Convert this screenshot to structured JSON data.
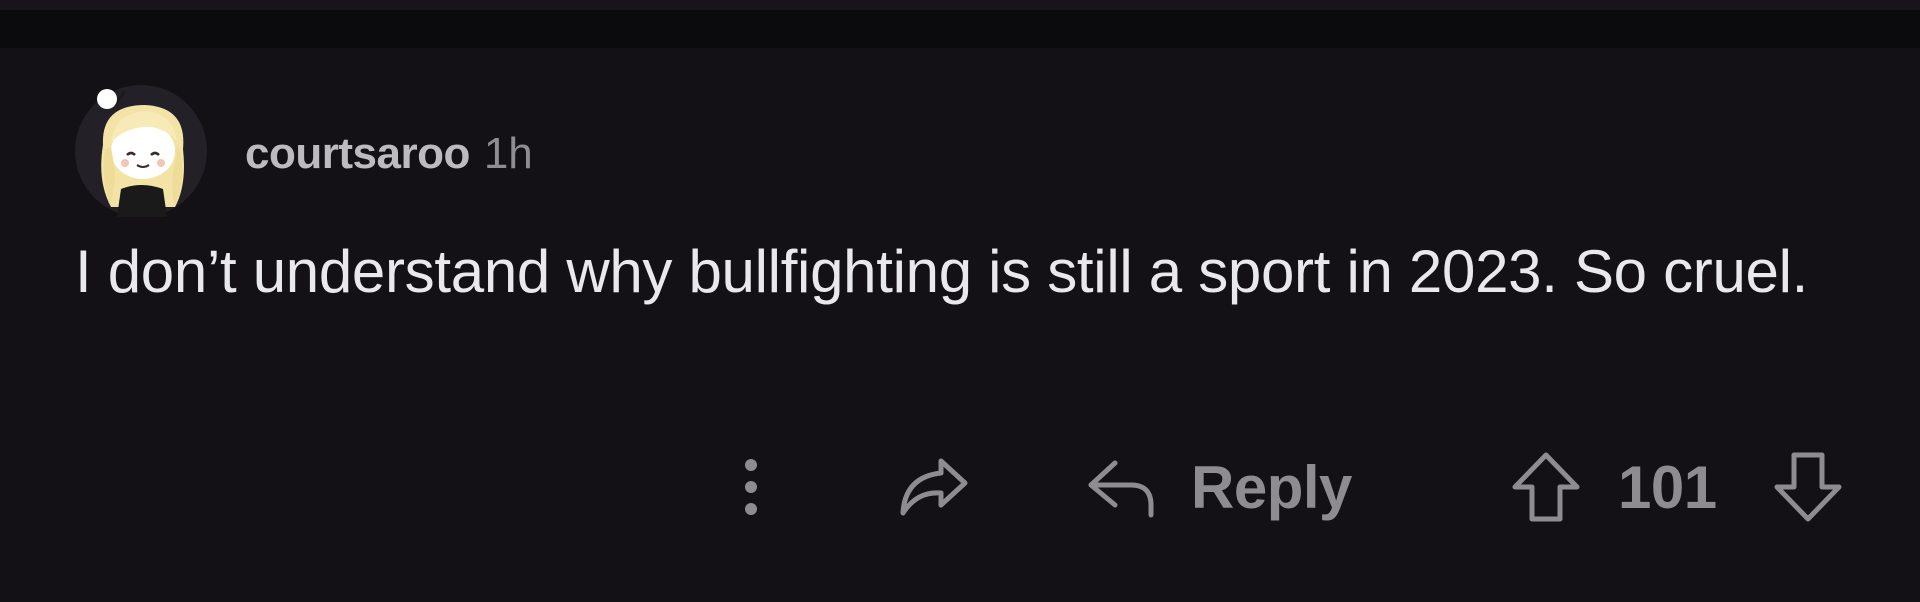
{
  "comment": {
    "username": "courtsaroo",
    "timestamp": "1h",
    "avatar_icon": "snoo-avatar-blonde-hair",
    "body": "I don’t understand why bullfighting is still a sport in 2023. So cruel."
  },
  "actions": {
    "more_icon": "vertical-dots-icon",
    "share_icon": "share-arrow-icon",
    "reply_icon": "reply-arrow-icon",
    "reply_label": "Reply",
    "upvote_icon": "up-arrow-icon",
    "score": "101",
    "downvote_icon": "down-arrow-icon"
  },
  "colors": {
    "background": "#131115",
    "username": "#bdbbc0",
    "body_text": "#e9e8ec",
    "muted": "#8e8c91"
  }
}
